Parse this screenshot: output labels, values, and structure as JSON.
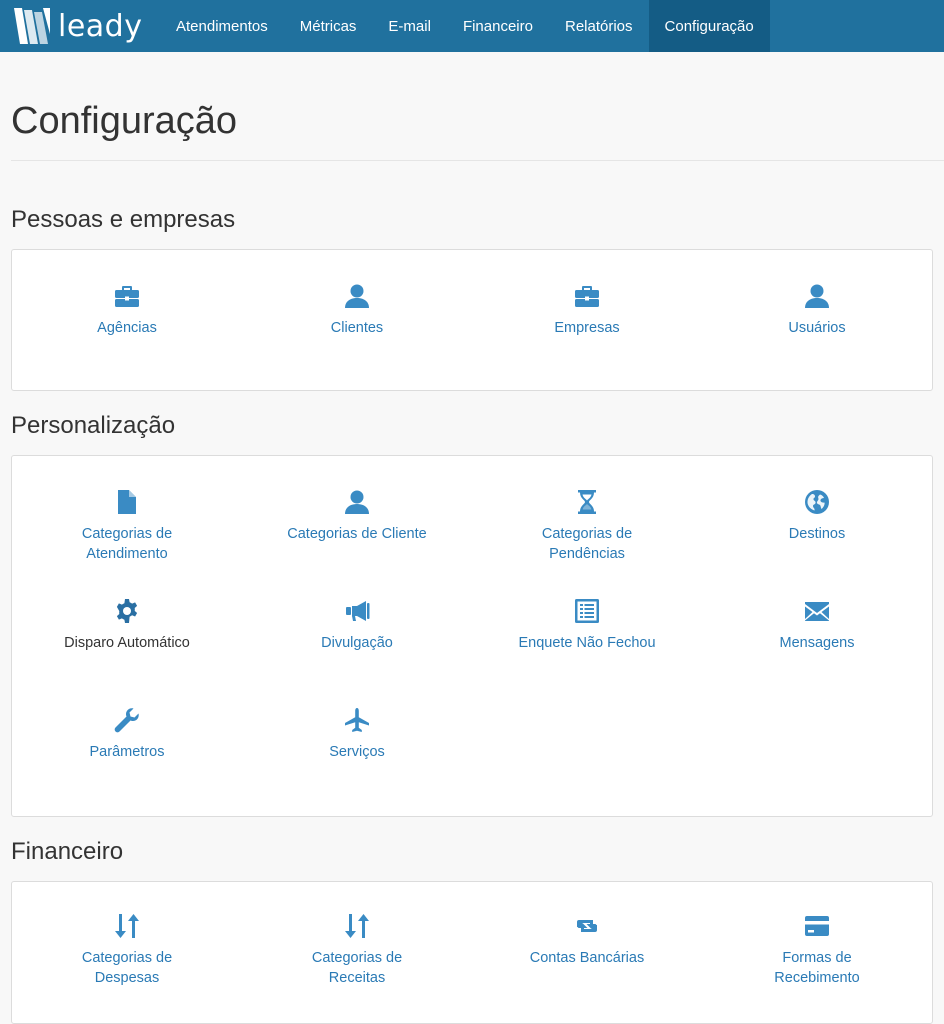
{
  "app": {
    "brand": "leady"
  },
  "nav": {
    "items": [
      {
        "label": "Atendimentos"
      },
      {
        "label": "Métricas"
      },
      {
        "label": "E-mail"
      },
      {
        "label": "Financeiro"
      },
      {
        "label": "Relatórios"
      },
      {
        "label": "Configuração",
        "active": true
      }
    ]
  },
  "page": {
    "title": "Configuração"
  },
  "sections": [
    {
      "title": "Pessoas e empresas",
      "items": [
        {
          "label": "Agências",
          "icon": "briefcase-icon"
        },
        {
          "label": "Clientes",
          "icon": "user-icon"
        },
        {
          "label": "Empresas",
          "icon": "briefcase-icon"
        },
        {
          "label": "Usuários",
          "icon": "user-icon"
        }
      ]
    },
    {
      "title": "Personalização",
      "items": [
        {
          "label": "Categorias de Atendimento",
          "icon": "file-icon"
        },
        {
          "label": "Categorias de Cliente",
          "icon": "user-icon"
        },
        {
          "label": "Categorias de Pendências",
          "icon": "hourglass-icon"
        },
        {
          "label": "Destinos",
          "icon": "globe-icon"
        },
        {
          "label": "Disparo Automático",
          "icon": "gear-icon"
        },
        {
          "label": "Divulgação",
          "icon": "megaphone-icon"
        },
        {
          "label": "Enquete Não Fechou",
          "icon": "list-alt-icon"
        },
        {
          "label": "Mensagens",
          "icon": "envelope-icon"
        },
        {
          "label": "Parâmetros",
          "icon": "wrench-icon"
        },
        {
          "label": "Serviços",
          "icon": "plane-icon"
        }
      ]
    },
    {
      "title": "Financeiro",
      "items": [
        {
          "label": "Categorias de Despesas",
          "icon": "sort-arrows-icon"
        },
        {
          "label": "Categorias de Receitas",
          "icon": "sort-arrows-icon"
        },
        {
          "label": "Contas Bancárias",
          "icon": "retweet-icon"
        },
        {
          "label": "Formas de Recebimento",
          "icon": "credit-card-icon"
        }
      ]
    }
  ],
  "colors": {
    "navbar": "#20719e",
    "nav_active": "#145c85",
    "link": "#2a7ab5",
    "icon": "#3a8bc4"
  }
}
